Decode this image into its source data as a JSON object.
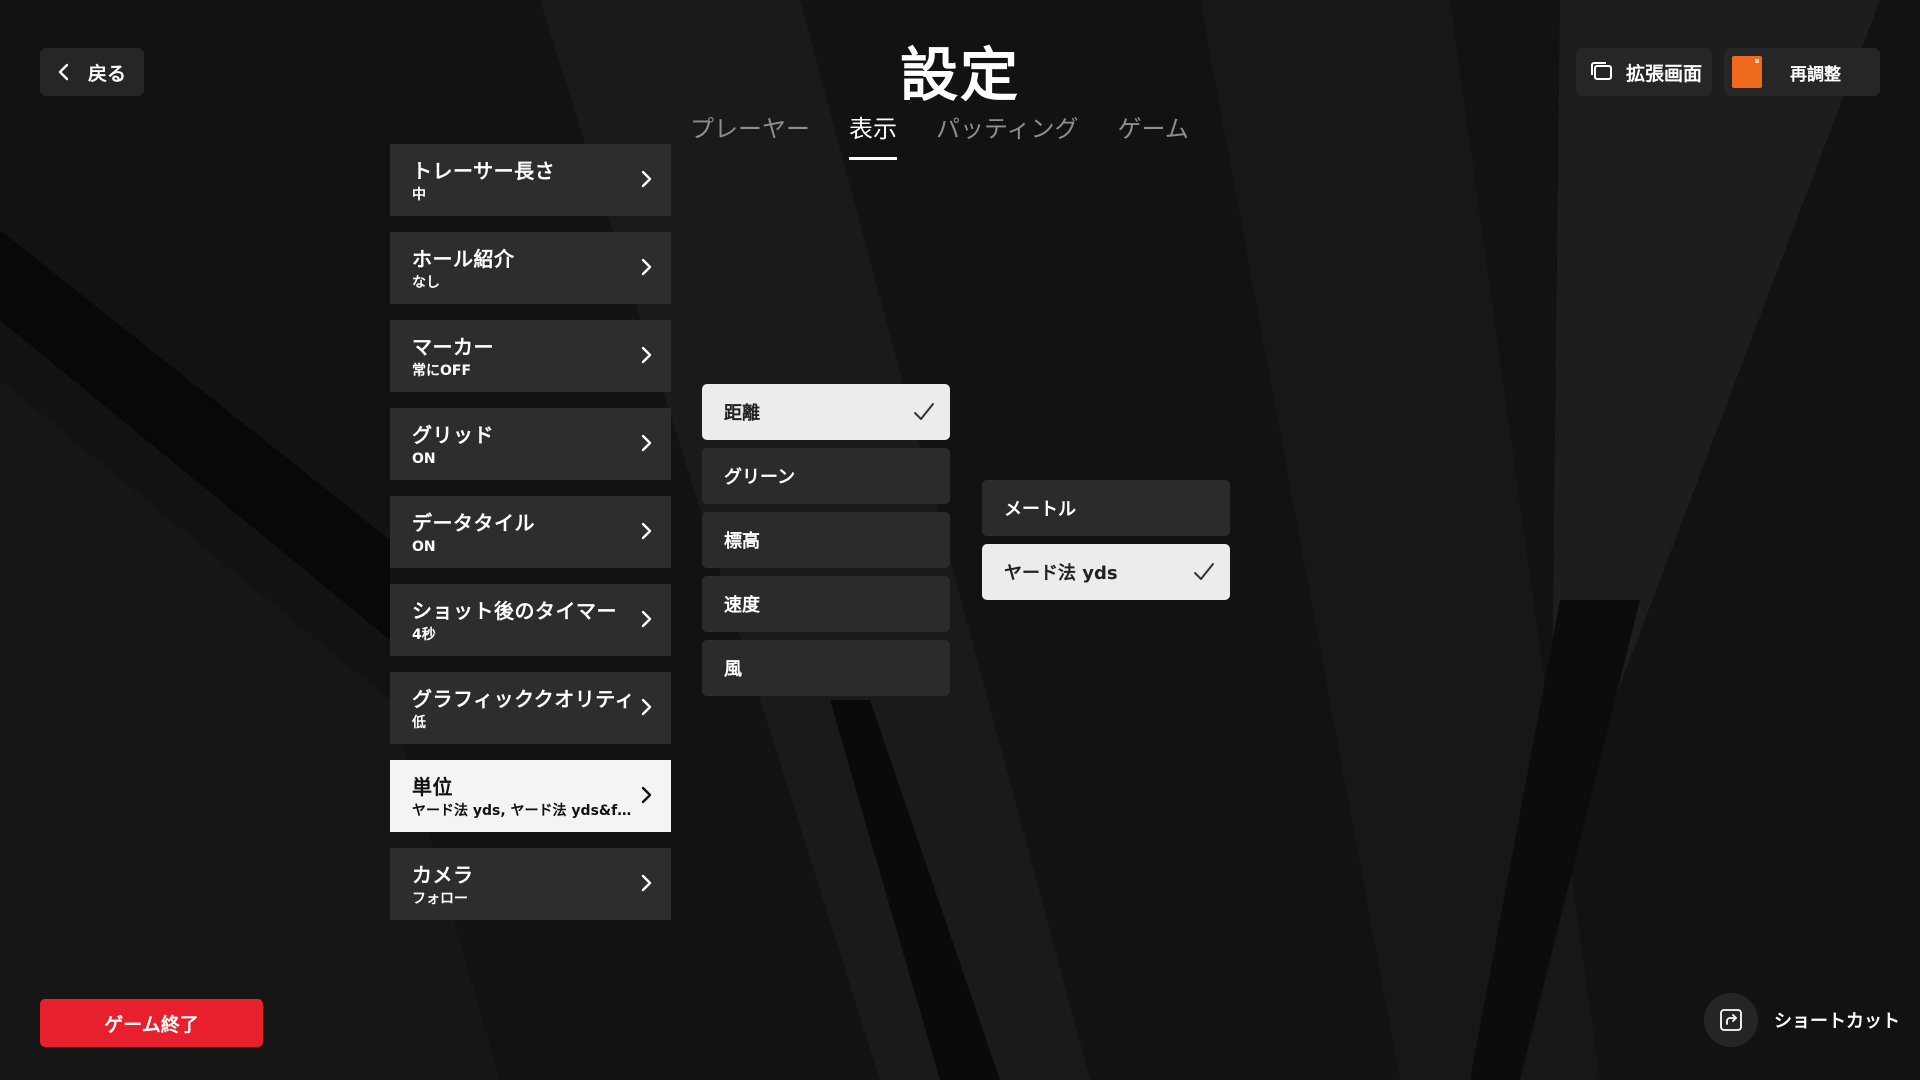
{
  "header": {
    "back_label": "戻る",
    "title": "設定",
    "extended_screen_label": "拡張画面",
    "recalibrate_label": "再調整"
  },
  "tabs": [
    {
      "label": "プレーヤー",
      "active": false
    },
    {
      "label": "表示",
      "active": true
    },
    {
      "label": "パッティング",
      "active": false
    },
    {
      "label": "ゲーム",
      "active": false
    }
  ],
  "settings": [
    {
      "label": "トレーサー長さ",
      "value": "中"
    },
    {
      "label": "ホール紹介",
      "value": "なし"
    },
    {
      "label": "マーカー",
      "value": "常にOFF"
    },
    {
      "label": "グリッド",
      "value": "ON"
    },
    {
      "label": "データタイル",
      "value": "ON"
    },
    {
      "label": "ショット後のタイマー",
      "value": "4秒"
    },
    {
      "label": "グラフィッククオリティ",
      "value": "低"
    },
    {
      "label": "単位",
      "value": "ヤード法 yds, ヤード法 yds&ft,..."
    },
    {
      "label": "カメラ",
      "value": "フォロー"
    }
  ],
  "selected_setting_index": 7,
  "unit_categories": [
    {
      "label": "距離",
      "selected": true
    },
    {
      "label": "グリーン",
      "selected": false
    },
    {
      "label": "標高",
      "selected": false
    },
    {
      "label": "速度",
      "selected": false
    },
    {
      "label": "風",
      "selected": false
    }
  ],
  "unit_options": [
    {
      "label": "メートル",
      "selected": false
    },
    {
      "label": "ヤード法 yds",
      "selected": true
    }
  ],
  "footer": {
    "quit_label": "ゲーム終了",
    "shortcut_label": "ショートカット"
  },
  "colors": {
    "background": "#111111",
    "panel": "#2d2d2d",
    "selected_panel": "#f4f4f4",
    "quit_red": "#e8202e",
    "recal_orange": "#ef6a1d"
  },
  "icons": {
    "back": "chevron-left-icon",
    "extended_screen": "windows-icon",
    "item_arrow": "chevron-right-icon",
    "selected": "check-icon",
    "shortcut": "share-icon"
  }
}
